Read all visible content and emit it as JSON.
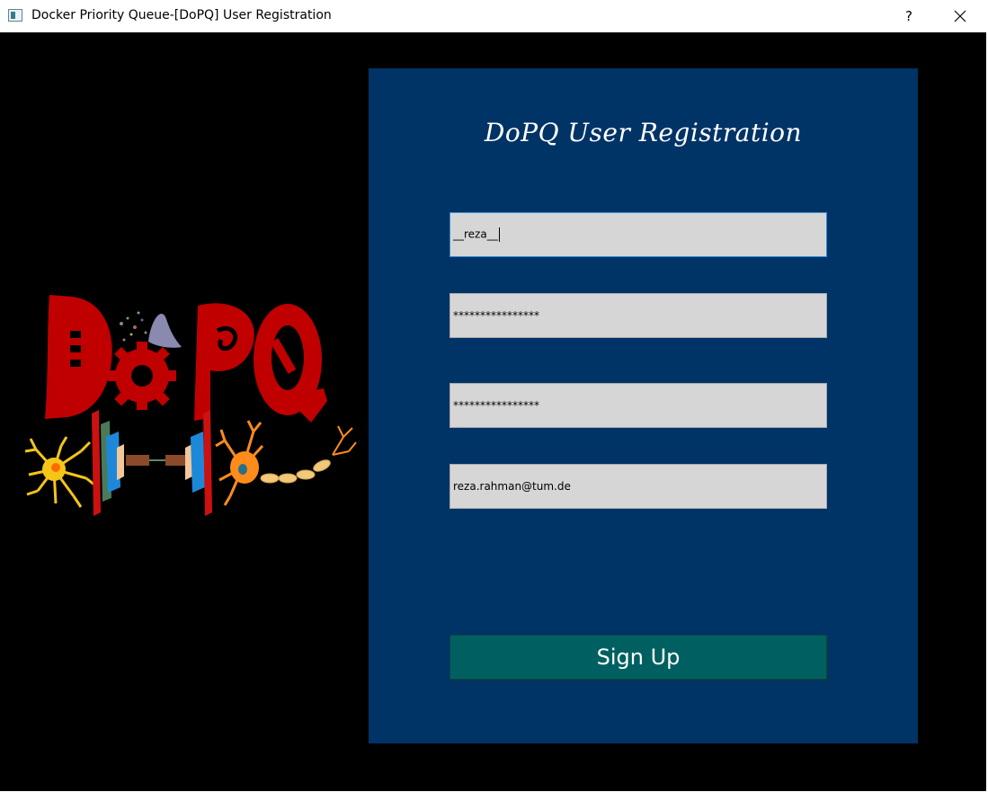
{
  "window": {
    "title": "Docker Priority Queue-[DoPQ] User Registration",
    "help_label": "?"
  },
  "logo": {
    "text": "DoPQ",
    "colors": {
      "letters": "#c00000",
      "neuron_left": "#f5c518",
      "neuron_right": "#ff8c1a"
    }
  },
  "form": {
    "heading": "DoPQ User Registration",
    "fields": [
      {
        "name": "username",
        "value": "__reza__"
      },
      {
        "name": "password",
        "value": "****************"
      },
      {
        "name": "confirm_password",
        "value": "****************"
      },
      {
        "name": "email",
        "value": "reza.rahman@tum.de"
      }
    ],
    "submit_label": "Sign Up"
  },
  "colors": {
    "panel": "#003366",
    "field_bg": "#d6d6d6",
    "focus_border": "#2b8fd6",
    "button": "#006061",
    "background": "#000000"
  }
}
